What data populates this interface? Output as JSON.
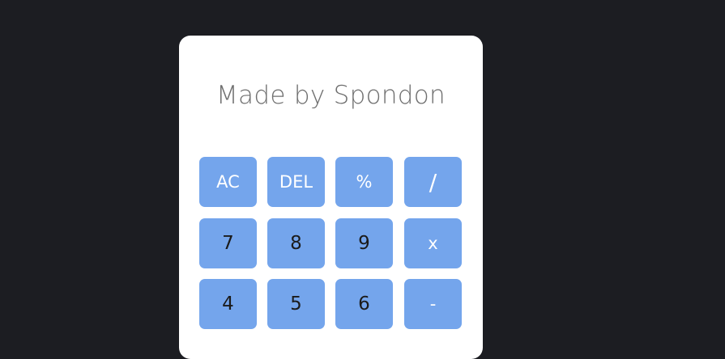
{
  "display": {
    "text": "Made by Spondon"
  },
  "keys": {
    "row1": [
      "AC",
      "DEL",
      "%",
      "/"
    ],
    "row2": [
      "7",
      "8",
      "9",
      "x"
    ],
    "row3": [
      "4",
      "5",
      "6",
      "-"
    ]
  },
  "colors": {
    "background": "#1c1d22",
    "card": "#ffffff",
    "key": "#74a5ec",
    "display_text": "#6f6f6f"
  }
}
